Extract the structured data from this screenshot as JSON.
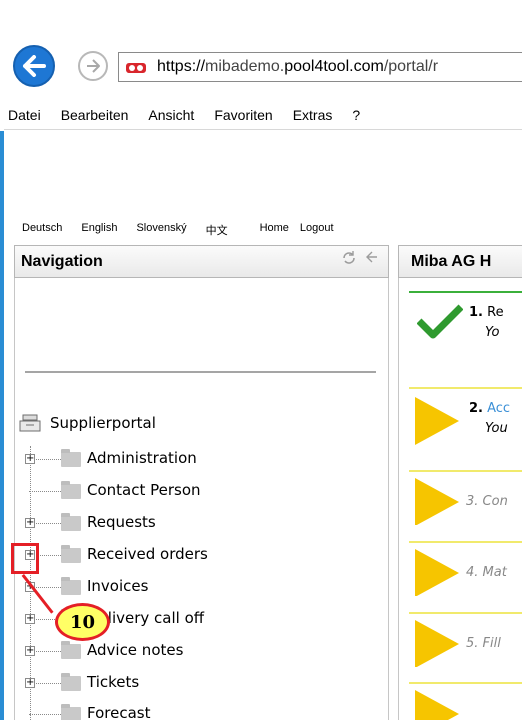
{
  "browser": {
    "url_prefix": "https://",
    "url_host_sub": "mibademo.",
    "url_host_main": "pool4tool.com",
    "url_path": "/portal/r",
    "menu": [
      "Datei",
      "Bearbeiten",
      "Ansicht",
      "Favoriten",
      "Extras",
      "?"
    ]
  },
  "languages": [
    "Deutsch",
    "English",
    "Slovenský",
    "中文"
  ],
  "top_links": {
    "home": "Home",
    "logout": "Logout"
  },
  "navigation": {
    "title": "Navigation",
    "root": "Supplierportal",
    "items": [
      {
        "label": "Administration",
        "expandable": true
      },
      {
        "label": "Contact Person",
        "expandable": false
      },
      {
        "label": "Requests",
        "expandable": true
      },
      {
        "label": "Received orders",
        "expandable": true
      },
      {
        "label": "Invoices",
        "expandable": true
      },
      {
        "label": "Delivery call off",
        "expandable": true
      },
      {
        "label": "Advice notes",
        "expandable": true
      },
      {
        "label": "Tickets",
        "expandable": true
      },
      {
        "label": "Forecast",
        "expandable": false
      }
    ]
  },
  "callout": {
    "number": "10"
  },
  "main_panel": {
    "title": "Miba AG H",
    "steps": [
      {
        "num": "1.",
        "title": "Re",
        "sub": "Yo",
        "state": "done"
      },
      {
        "num": "2.",
        "title": "Acc",
        "sub": "You",
        "state": "active"
      },
      {
        "num": "",
        "title": "3. Con",
        "sub": "",
        "state": "pending"
      },
      {
        "num": "",
        "title": "4. Mat",
        "sub": "",
        "state": "pending"
      },
      {
        "num": "",
        "title": "5. Fill",
        "sub": "",
        "state": "pending"
      }
    ]
  },
  "colors": {
    "accent_blue": "#1e77d4",
    "highlight_red": "#e41f26",
    "callout_yellow": "#ffff66",
    "step_yellow": "#f6c500",
    "done_green": "#3bb03b"
  }
}
